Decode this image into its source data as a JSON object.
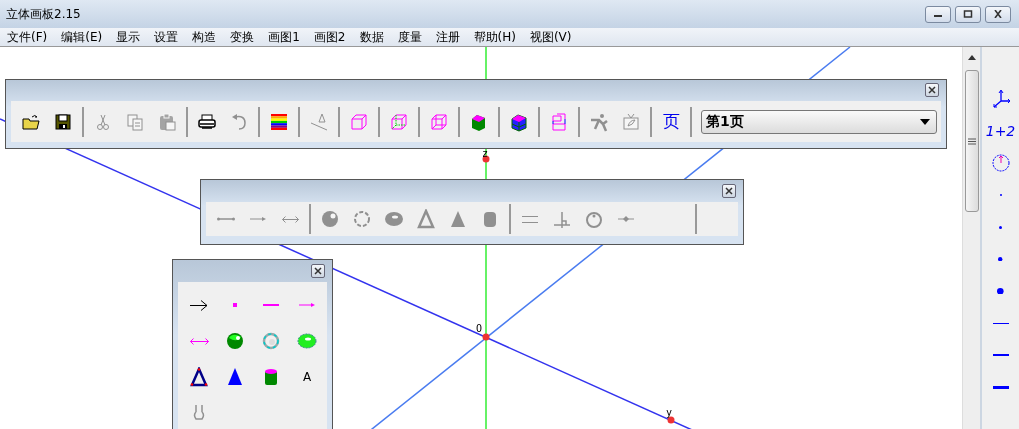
{
  "window": {
    "title": "立体画板2.15"
  },
  "menu": [
    "文件(F)",
    "编辑(E)",
    "显示",
    "设置",
    "构造",
    "变换",
    "画图1",
    "画图2",
    "数据",
    "度量",
    "注册",
    "帮助(H)",
    "视图(V)"
  ],
  "main_toolbar": {
    "tools": [
      {
        "kind": "open",
        "disabled": false
      },
      {
        "kind": "save",
        "disabled": false
      },
      {
        "kind": "separator"
      },
      {
        "kind": "cut",
        "disabled": true
      },
      {
        "kind": "copy",
        "disabled": true
      },
      {
        "kind": "paste",
        "disabled": true
      },
      {
        "kind": "separator"
      },
      {
        "kind": "print",
        "disabled": false
      },
      {
        "kind": "undo",
        "disabled": true
      },
      {
        "kind": "separator"
      },
      {
        "kind": "colors",
        "disabled": false
      },
      {
        "kind": "separator"
      },
      {
        "kind": "label-line",
        "disabled": true
      },
      {
        "kind": "separator"
      },
      {
        "kind": "cube",
        "disabled": false
      },
      {
        "kind": "separator"
      },
      {
        "kind": "cube-inner",
        "disabled": false
      },
      {
        "kind": "separator"
      },
      {
        "kind": "cube-double",
        "disabled": false
      },
      {
        "kind": "separator"
      },
      {
        "kind": "prism-green",
        "disabled": false
      },
      {
        "kind": "separator"
      },
      {
        "kind": "prism-blue",
        "disabled": false
      },
      {
        "kind": "separator"
      },
      {
        "kind": "cube-net",
        "disabled": false
      },
      {
        "kind": "separator"
      },
      {
        "kind": "runner",
        "disabled": true
      },
      {
        "kind": "tv",
        "disabled": true
      },
      {
        "kind": "separator"
      },
      {
        "kind": "text",
        "label": "页",
        "disabled": false
      },
      {
        "kind": "separator"
      }
    ],
    "page_select": {
      "value": "第1页"
    }
  },
  "shape_toolbar": {
    "tools": [
      {
        "kind": "segment",
        "disabled": true
      },
      {
        "kind": "ray",
        "disabled": true
      },
      {
        "kind": "double-arrow",
        "disabled": true
      },
      {
        "kind": "separator"
      },
      {
        "kind": "sphere",
        "disabled": true
      },
      {
        "kind": "circle",
        "disabled": true
      },
      {
        "kind": "torus",
        "disabled": true
      },
      {
        "kind": "triangle",
        "disabled": true
      },
      {
        "kind": "cone",
        "disabled": true
      },
      {
        "kind": "cylinder",
        "disabled": true
      },
      {
        "kind": "separator"
      },
      {
        "kind": "parallel",
        "disabled": true
      },
      {
        "kind": "perpendicular",
        "disabled": true
      },
      {
        "kind": "circle-point",
        "disabled": true
      },
      {
        "kind": "point-on-line",
        "disabled": true
      },
      {
        "kind": "gap"
      },
      {
        "kind": "separator"
      }
    ]
  },
  "toolbox": {
    "tools": [
      {
        "kind": "pointer",
        "disabled": false
      },
      {
        "kind": "point",
        "disabled": false
      },
      {
        "kind": "line",
        "disabled": false
      },
      {
        "kind": "ray-color",
        "disabled": false
      },
      {
        "kind": "double-arrow-color",
        "disabled": false
      },
      {
        "kind": "sphere-color",
        "disabled": false
      },
      {
        "kind": "circle-color",
        "disabled": false
      },
      {
        "kind": "torus-color",
        "disabled": false
      },
      {
        "kind": "triangle-color",
        "disabled": false
      },
      {
        "kind": "cone-color",
        "disabled": false
      },
      {
        "kind": "cylinder-color",
        "disabled": false
      },
      {
        "kind": "text",
        "label": "A",
        "disabled": false
      },
      {
        "kind": "caliper",
        "disabled": true
      }
    ]
  },
  "canvas": {
    "points": [
      {
        "label": "z"
      },
      {
        "label": "O"
      },
      {
        "label": "y"
      }
    ]
  },
  "right_panel": {
    "tools": [
      {
        "kind": "axes"
      },
      {
        "kind": "text",
        "label": "1+2"
      },
      {
        "kind": "clock"
      },
      {
        "kind": "dot-1"
      },
      {
        "kind": "dot-2"
      },
      {
        "kind": "dot-3"
      },
      {
        "kind": "dot-4"
      },
      {
        "kind": "line-1"
      },
      {
        "kind": "line-2"
      },
      {
        "kind": "line-3"
      }
    ]
  }
}
